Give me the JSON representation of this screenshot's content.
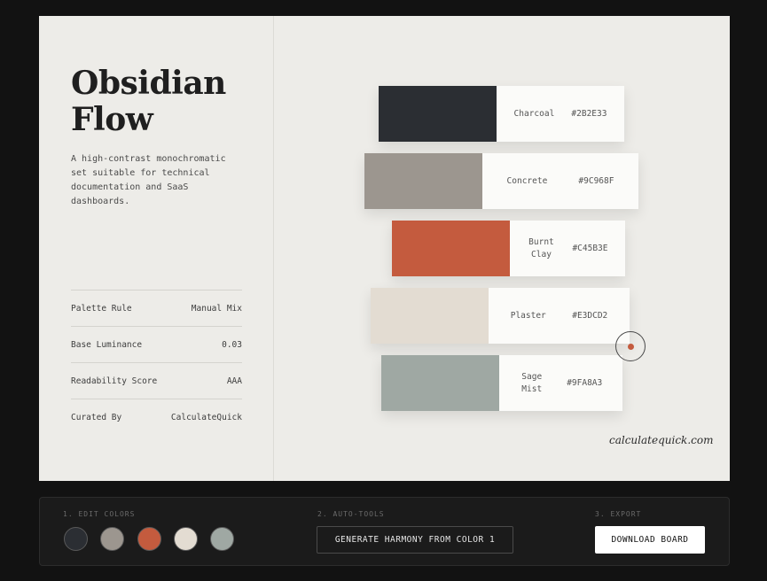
{
  "palette": {
    "title_line1": "Obsidian",
    "title_line2": "Flow",
    "description": "A high-contrast monochromatic set suitable for technical documentation and SaaS dashboards.",
    "meta": [
      {
        "label": "Palette Rule",
        "value": "Manual Mix"
      },
      {
        "label": "Base Luminance",
        "value": "0.03"
      },
      {
        "label": "Readability Score",
        "value": "AAA"
      },
      {
        "label": "Curated By",
        "value": "CalculateQuick"
      }
    ],
    "swatches": [
      {
        "name": "Charcoal",
        "hex": "#2B2E33",
        "color": "#2b2e33"
      },
      {
        "name": "Concrete",
        "hex": "#9C968F",
        "color": "#9c968f"
      },
      {
        "name": "Burnt Clay",
        "hex": "#C45B3E",
        "color": "#c45b3e"
      },
      {
        "name": "Plaster",
        "hex": "#E3DCD2",
        "color": "#e3dcd2"
      },
      {
        "name": "Sage Mist",
        "hex": "#9FA8A3",
        "color": "#9fa8a3"
      }
    ],
    "signature": "calculatequick.com"
  },
  "toolbar": {
    "edit_label": "1. EDIT COLORS",
    "auto_label": "2. AUTO-TOOLS",
    "export_label": "3. EXPORT",
    "generate_button": "GENERATE HARMONY FROM COLOR 1",
    "download_button": "DOWNLOAD BOARD"
  }
}
